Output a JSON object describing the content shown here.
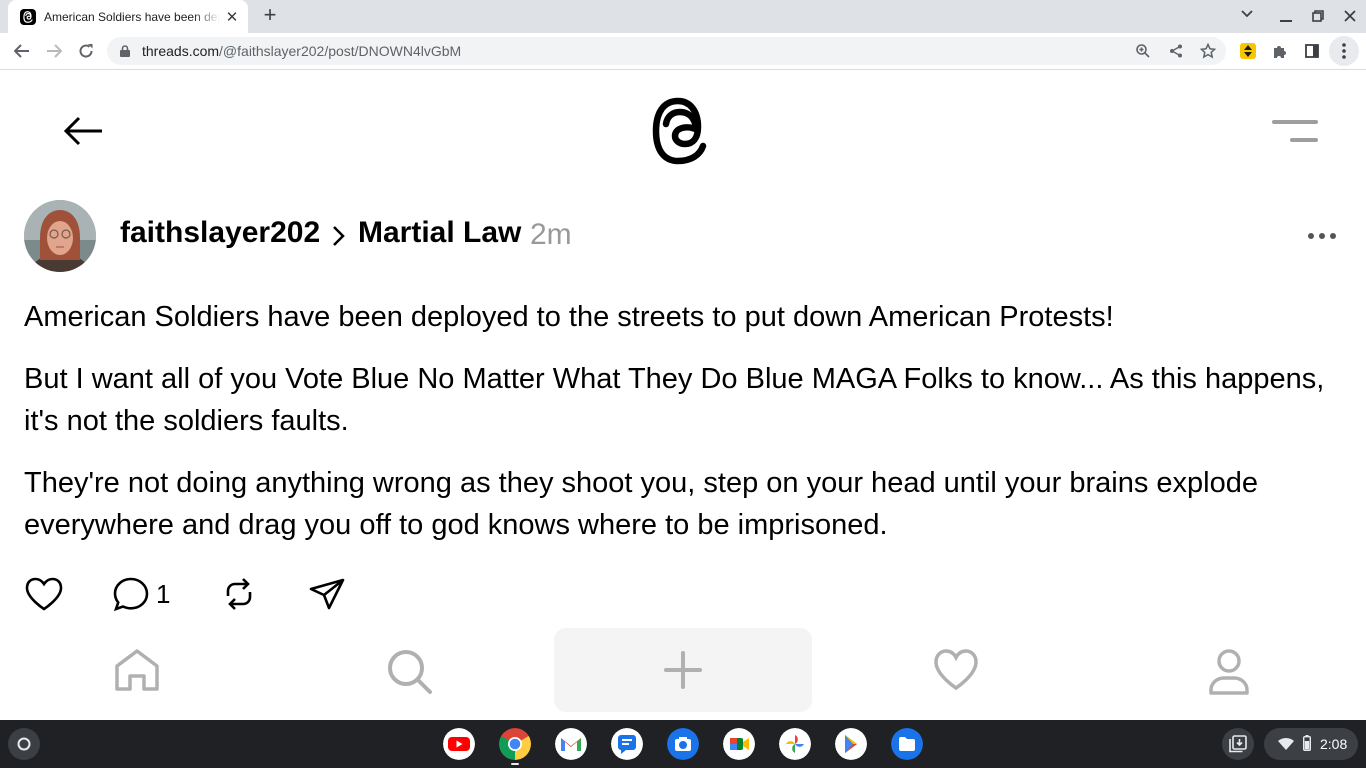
{
  "browser": {
    "tab_title": "American Soldiers have been deployed",
    "url_host": "threads.com",
    "url_path": "/@faithslayer202/post/DNOWN4lvGbM"
  },
  "post": {
    "author": "faithslayer202",
    "topic": "Martial Law",
    "time": "2m",
    "paragraphs": [
      "American Soldiers have been deployed to the streets to put down American Protests!",
      "But I want all of you Vote Blue No Matter What They Do Blue MAGA Folks to know... As this happens, it's not the soldiers faults.",
      "They're not doing anything wrong as they shoot you, step on your head until your brains explode everywhere and drag you off to god knows where to be imprisoned."
    ],
    "reply_count": "1"
  },
  "shelf": {
    "clock": "2:08",
    "apps": [
      "youtube-icon",
      "chrome-icon",
      "gmail-icon",
      "messages-icon",
      "camera-icon",
      "meet-icon",
      "photos-icon",
      "play-store-icon",
      "files-icon"
    ]
  }
}
